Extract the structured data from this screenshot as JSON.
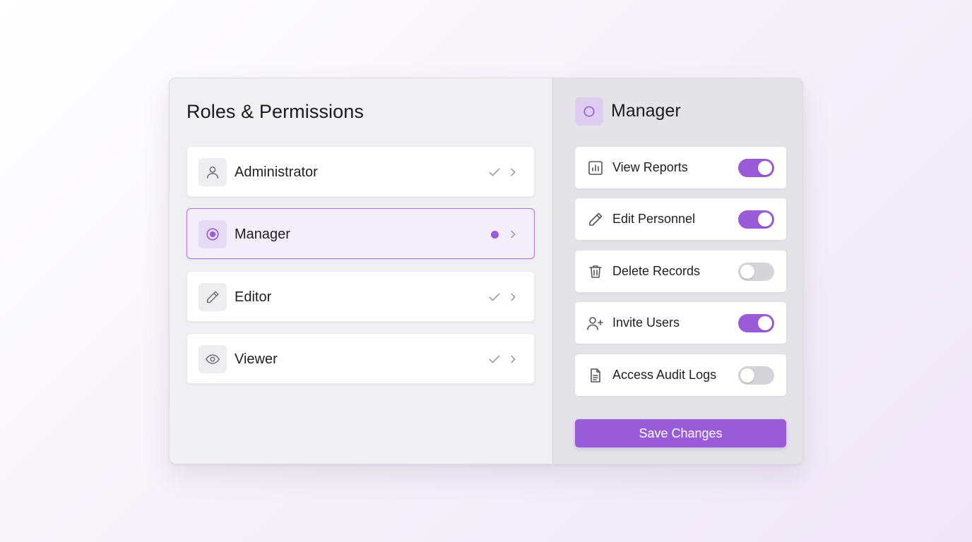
{
  "panel": {
    "title": "Roles & Permissions",
    "roles": [
      {
        "label": "Administrator",
        "icon": "user-icon",
        "status": "check",
        "selected": false
      },
      {
        "label": "Manager",
        "icon": "radio-icon",
        "status": "dot",
        "selected": true
      },
      {
        "label": "Editor",
        "icon": "pencil-icon",
        "status": "check",
        "selected": false
      },
      {
        "label": "Viewer",
        "icon": "eye-icon",
        "status": "check",
        "selected": false
      }
    ]
  },
  "detail": {
    "title": "Manager",
    "icon": "circle-icon",
    "permissions": [
      {
        "label": "View Reports",
        "icon": "bar-chart-icon",
        "enabled": true
      },
      {
        "label": "Edit Personnel",
        "icon": "pencil-icon",
        "enabled": true
      },
      {
        "label": "Delete Records",
        "icon": "trash-icon",
        "enabled": false
      },
      {
        "label": "Invite Users",
        "icon": "user-plus-icon",
        "enabled": true
      },
      {
        "label": "Access Audit Logs",
        "icon": "document-icon",
        "enabled": false
      }
    ],
    "save_label": "Save Changes"
  },
  "colors": {
    "accent": "#9a5bd8",
    "selected_bg": "#f3eefa",
    "selected_border": "#a57ad8",
    "toggle_off": "#d4d4d9",
    "right_panel_bg": "#e3e3e8",
    "left_panel_bg": "#f0f0f3"
  }
}
